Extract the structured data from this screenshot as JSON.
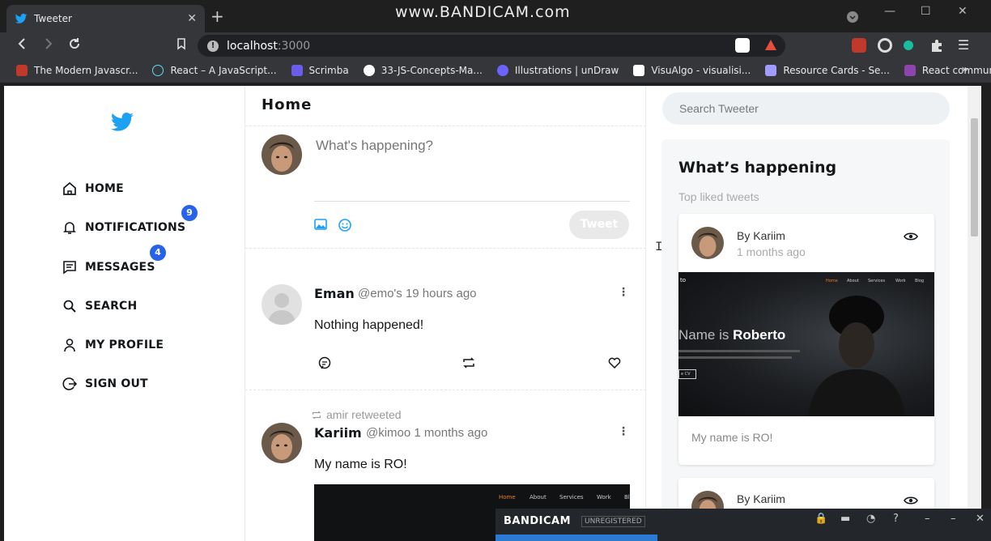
{
  "browser": {
    "tab_title": "Tweeter",
    "tab_close": "✕",
    "new_tab": "+",
    "watermark": "www.BANDICAM.com",
    "url_host": "localhost",
    "url_port": ":3000",
    "bookmarks": [
      {
        "label": "The Modern Javascr...",
        "color": "#c0392b"
      },
      {
        "label": "React – A JavaScript...",
        "color": "#61dafb"
      },
      {
        "label": "Scrimba",
        "color": "#6c5ce7"
      },
      {
        "label": "33-JS-Concepts-Ma...",
        "color": "#ffffff"
      },
      {
        "label": "Illustrations | unDraw",
        "color": "#6c63ff"
      },
      {
        "label": "VisuAlgo - visualisi...",
        "color": "#ffffff"
      },
      {
        "label": "Resource Cards - Se...",
        "color": "#a29bfe"
      },
      {
        "label": "React community",
        "color": "#8e44ad"
      }
    ],
    "more": "»"
  },
  "sidebar": {
    "items": [
      {
        "label": "HOME",
        "icon": "home-icon"
      },
      {
        "label": "NOTIFICATIONS",
        "icon": "bell-icon",
        "badge": "9"
      },
      {
        "label": "MESSAGES",
        "icon": "message-icon",
        "badge": "4"
      },
      {
        "label": "SEARCH",
        "icon": "search-icon"
      },
      {
        "label": "MY PROFILE",
        "icon": "user-icon"
      },
      {
        "label": "SIGN OUT",
        "icon": "sign-out-icon"
      }
    ]
  },
  "main": {
    "title": "Home",
    "compose_placeholder": "What's happening?",
    "tweet_button": "Tweet",
    "tweets": [
      {
        "name": "Eman",
        "meta": "@emo's 19 hours ago",
        "text": "Nothing happened!"
      },
      {
        "retweeted_by": "amir retweeted",
        "name": "Kariim",
        "meta": "@kimoo 1 months ago",
        "text": "My name is RO!",
        "image_nav": [
          "Home",
          "About",
          "Services",
          "Work",
          "Bl"
        ]
      }
    ]
  },
  "aside": {
    "search_placeholder": "Search Tweeter",
    "heading": "What’s happening",
    "subheading": "Top liked tweets",
    "cards": [
      {
        "by": "By Kariim",
        "ago": "1 months ago",
        "image_prefix": "Name is",
        "image_name": "Roberto",
        "image_logo": "to",
        "image_nav": [
          "Home",
          "About",
          "Services",
          "Work",
          "Blog"
        ],
        "image_button": "e CV",
        "caption": "My name is RO!"
      },
      {
        "by": "By Kariim"
      }
    ]
  },
  "bandicam": {
    "brand": "BANDICAM",
    "status": "UNREGISTERED"
  },
  "colors": {
    "twitter_blue": "#1da1f2",
    "badge_blue": "#2563eb"
  }
}
